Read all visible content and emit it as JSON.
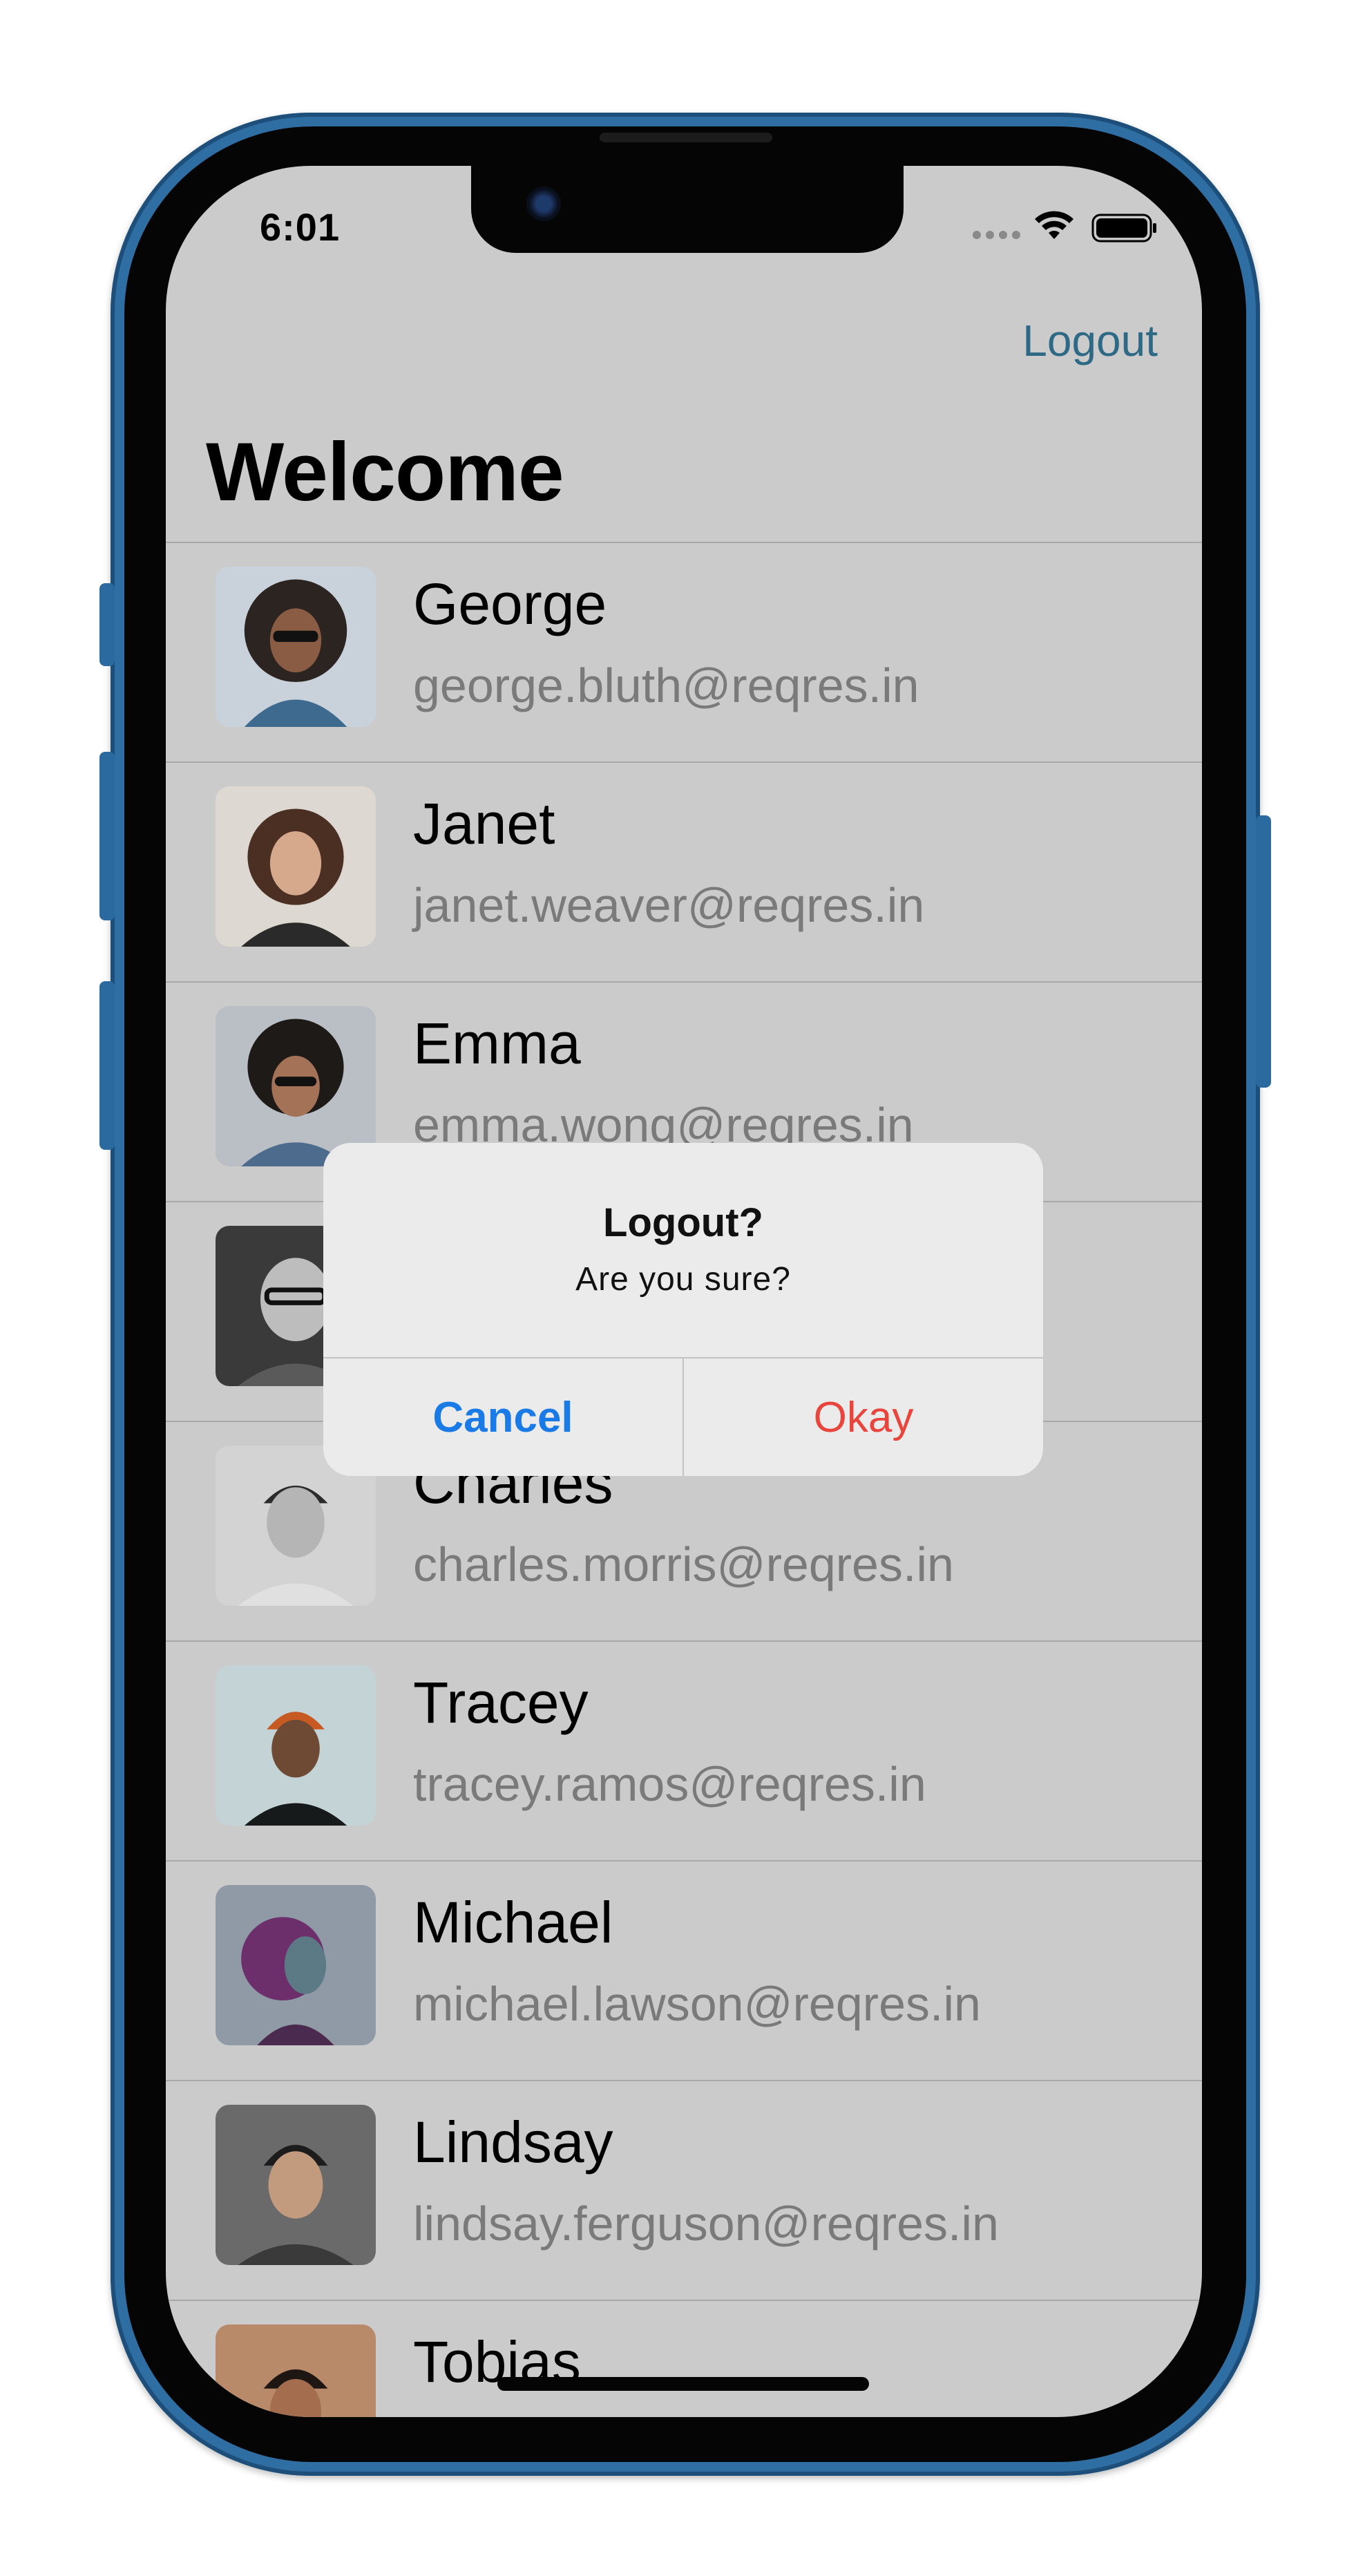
{
  "status_bar": {
    "time": "6:01"
  },
  "nav": {
    "logout_label": "Logout",
    "title": "Welcome"
  },
  "users": [
    {
      "name": "George",
      "email": "george.bluth@reqres.in"
    },
    {
      "name": "Janet",
      "email": "janet.weaver@reqres.in"
    },
    {
      "name": "Emma",
      "email": "emma.wong@reqres.in"
    },
    {
      "name": "",
      "email": ""
    },
    {
      "name": "Charles",
      "email": "charles.morris@reqres.in"
    },
    {
      "name": "Tracey",
      "email": "tracey.ramos@reqres.in"
    },
    {
      "name": "Michael",
      "email": "michael.lawson@reqres.in"
    },
    {
      "name": "Lindsay",
      "email": "lindsay.ferguson@reqres.in"
    },
    {
      "name": "Tobias",
      "email": ""
    }
  ],
  "alert": {
    "title": "Logout?",
    "message": "Are you sure?",
    "cancel_label": "Cancel",
    "okay_label": "Okay"
  },
  "colors": {
    "screen_dim": "#cbcbcb",
    "link": "#2e6a85",
    "alert_cancel": "#1a7ae6",
    "alert_okay": "#e8453c",
    "phone_frame": "#2f6ea3"
  }
}
